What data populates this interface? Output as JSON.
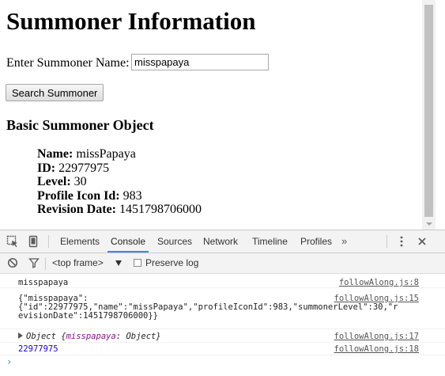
{
  "page": {
    "title": "Summoner Information",
    "name_label": "Enter Summoner Name:",
    "name_value": "misspapaya",
    "search_button": "Search Summoner",
    "section_heading": "Basic Summoner Object",
    "fields": [
      {
        "label": "Name:",
        "value": "missPapaya"
      },
      {
        "label": "ID:",
        "value": "22977975"
      },
      {
        "label": "Level:",
        "value": "30"
      },
      {
        "label": "Profile Icon Id:",
        "value": "983"
      },
      {
        "label": "Revision Date:",
        "value": "1451798706000"
      }
    ]
  },
  "devtools": {
    "tabs": [
      "Elements",
      "Console",
      "Sources",
      "Network",
      "Timeline",
      "Profiles"
    ],
    "active_tab": "Console",
    "more_tabs": "»",
    "frame_select": "<top frame>",
    "preserve_log": "Preserve log",
    "preserve_log_checked": false,
    "accent_color": "#3e82f7",
    "console": [
      {
        "message": "misspapaya",
        "source": "followAlong.js:8"
      },
      {
        "message": "{\"misspapaya\":\n{\"id\":22977975,\"name\":\"missPapaya\",\"profileIconId\":983,\"summonerLevel\":30,\"r\nevisionDate\":1451798706000}}",
        "source": "followAlong.js:15"
      },
      {
        "object_prefix": "Object {",
        "object_key": "misspapaya",
        "object_suffix": ": Object}",
        "source": "followAlong.js:17"
      },
      {
        "message": "22977975",
        "source": "followAlong.js:18"
      }
    ],
    "prompt": "›"
  }
}
